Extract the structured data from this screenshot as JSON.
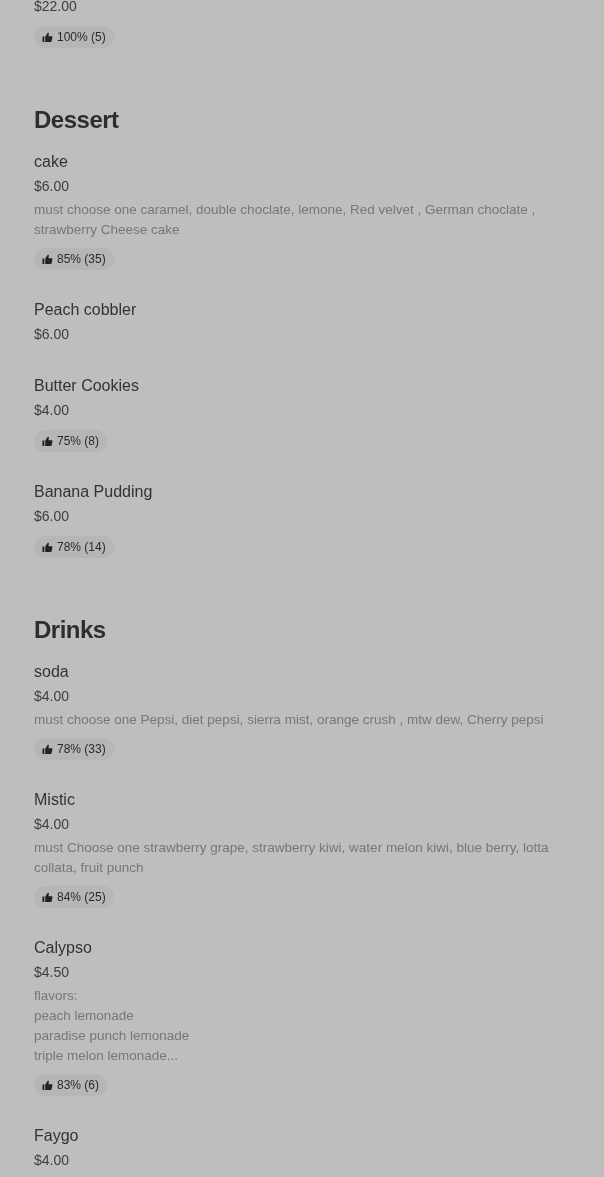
{
  "sections": [
    {
      "items": [
        {
          "price": "$22.00",
          "rating": "100% (5)"
        }
      ]
    },
    {
      "title": "Dessert",
      "items": [
        {
          "name": "cake",
          "price": "$6.00",
          "description": "must choose one caramel, double choclate, lemone, Red velvet , German choclate , strawberry Cheese cake",
          "rating": "85% (35)"
        },
        {
          "name": "Peach cobbler",
          "price": "$6.00"
        },
        {
          "name": "Butter Cookies",
          "price": "$4.00",
          "rating": "75% (8)"
        },
        {
          "name": "Banana Pudding",
          "price": "$6.00",
          "rating": "78% (14)"
        }
      ]
    },
    {
      "title": "Drinks",
      "items": [
        {
          "name": "soda",
          "price": "$4.00",
          "description": "must choose one Pepsi, diet pepsi, sierra mist, orange crush , mtw dew, Cherry pepsi",
          "rating": "78% (33)"
        },
        {
          "name": "Mistic",
          "price": "$4.00",
          "description": "must Choose one strawberry grape, strawberry kiwi, water melon kiwi, blue berry, lotta collata, fruit punch",
          "rating": "84% (25)"
        },
        {
          "name": "Calypso",
          "price": "$4.50",
          "description": "flavors:\npeach lemonade\nparadise punch lemonade\ntriple melon lemonade...",
          "rating": "83% (6)"
        },
        {
          "name": "Faygo",
          "price": "$4.00"
        }
      ]
    }
  ]
}
